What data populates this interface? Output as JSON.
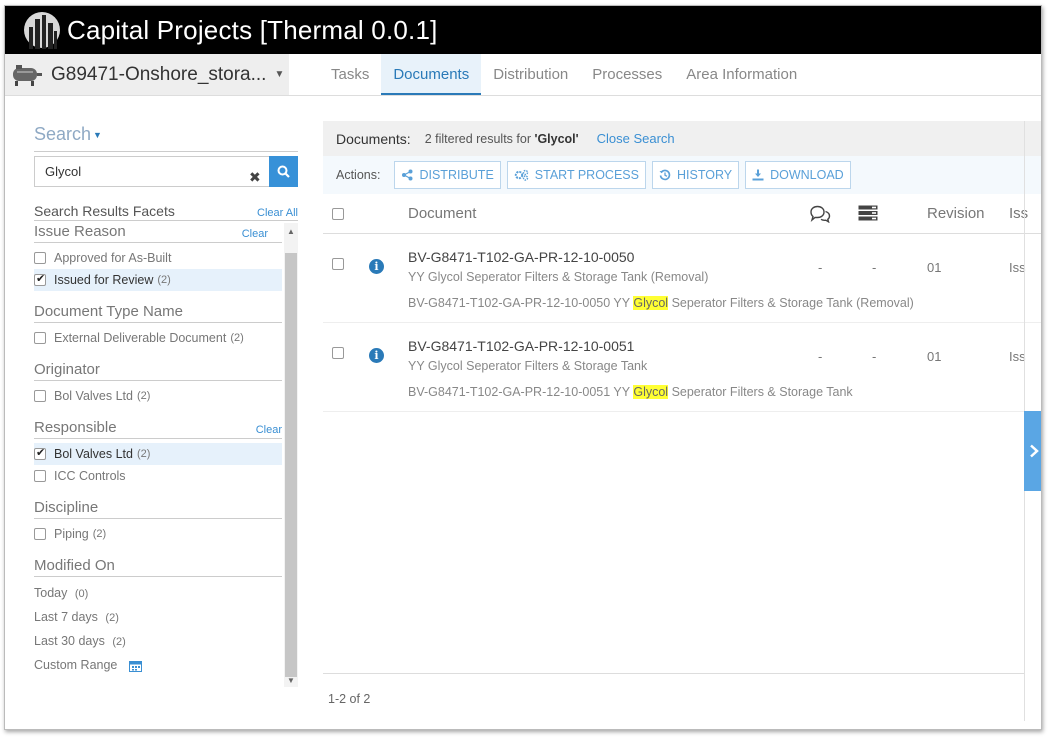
{
  "app": {
    "title": "Capital Projects [Thermal 0.0.1]"
  },
  "project": {
    "name": "G89471-Onshore_stora..."
  },
  "tabs": [
    {
      "label": "Tasks"
    },
    {
      "label": "Documents",
      "active": true
    },
    {
      "label": "Distribution"
    },
    {
      "label": "Processes"
    },
    {
      "label": "Area Information"
    }
  ],
  "sidebar": {
    "search_label": "Search",
    "search_value": "Glycol",
    "facets_title": "Search Results Facets",
    "clear_all": "Clear All",
    "clear": "Clear",
    "groups": [
      {
        "title": "Issue Reason",
        "options": [
          {
            "label": "Approved for As-Built",
            "count": "",
            "checked": false
          },
          {
            "label": "Issued for Review",
            "count": "(2)",
            "checked": true
          }
        ]
      },
      {
        "title": "Document Type Name",
        "options": [
          {
            "label": "External Deliverable Document",
            "count": "(2)",
            "checked": false
          }
        ]
      },
      {
        "title": "Originator",
        "options": [
          {
            "label": "Bol Valves Ltd",
            "count": "(2)",
            "checked": false
          }
        ]
      },
      {
        "title": "Responsible",
        "options": [
          {
            "label": "Bol Valves Ltd",
            "count": "(2)",
            "checked": true
          },
          {
            "label": "ICC Controls",
            "count": "",
            "checked": false
          }
        ]
      },
      {
        "title": "Discipline",
        "options": [
          {
            "label": "Piping",
            "count": "(2)",
            "checked": false
          }
        ]
      }
    ],
    "modified": {
      "title": "Modified On",
      "options": [
        {
          "label": "Today",
          "count": "(0)"
        },
        {
          "label": "Last 7 days",
          "count": "(2)"
        },
        {
          "label": "Last 30 days",
          "count": "(2)"
        }
      ],
      "custom_range": "Custom Range"
    }
  },
  "results": {
    "label": "Documents:",
    "info_prefix": "2 filtered results for ",
    "query": "'Glycol'",
    "close_search": "Close Search"
  },
  "actions": {
    "label": "Actions:",
    "distribute": "DISTRIBUTE",
    "start_process": "START PROCESS",
    "history": "HISTORY",
    "download": "DOWNLOAD"
  },
  "table": {
    "col_document": "Document",
    "col_revision": "Revision",
    "col_issue": "Iss",
    "rows": [
      {
        "number": "BV-G8471-T102-GA-PR-12-10-0050",
        "title": "YY Glycol Seperator Filters & Storage Tank (Removal)",
        "full_prefix": "BV-G8471-T102-GA-PR-12-10-0050 YY ",
        "full_hl": "Glycol",
        "full_suffix": " Seperator Filters & Storage Tank (Removal)",
        "comments": "-",
        "stack": "-",
        "revision": "01",
        "issue": "Iss"
      },
      {
        "number": "BV-G8471-T102-GA-PR-12-10-0051",
        "title": "YY Glycol Seperator Filters & Storage Tank",
        "full_prefix": "BV-G8471-T102-GA-PR-12-10-0051 YY ",
        "full_hl": "Glycol",
        "full_suffix": " Seperator Filters & Storage Tank",
        "comments": "-",
        "stack": "-",
        "revision": "01",
        "issue": "Iss"
      }
    ]
  },
  "pagination": "1-2 of 2"
}
